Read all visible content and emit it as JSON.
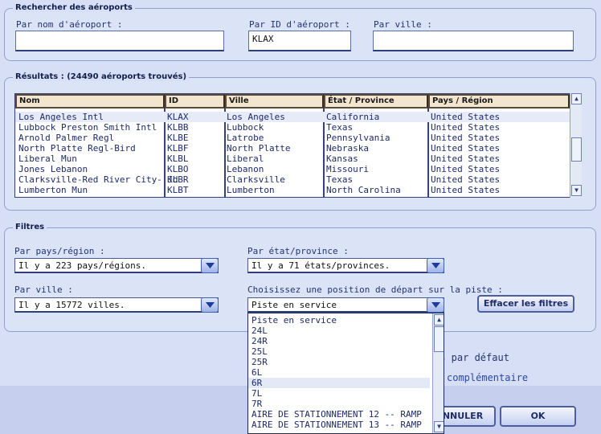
{
  "search": {
    "title": "Rechercher des aéroports",
    "by_name_label": "Par nom d'aéroport :",
    "by_name_value": "",
    "by_id_label": "Par ID d'aéroport :",
    "by_id_value": "KLAX",
    "by_city_label": "Par ville :",
    "by_city_value": ""
  },
  "results": {
    "title": "Résultats : (24490 aéroports trouvés)",
    "columns": [
      "Nom",
      "ID",
      "Ville",
      "État / Province",
      "Pays / Région"
    ],
    "rows": [
      [
        "Los Angeles Intl",
        "KLAX",
        "Los Angeles",
        "California",
        "United States"
      ],
      [
        "Lubbock Preston Smith Intl",
        "KLBB",
        "Lubbock",
        "Texas",
        "United States"
      ],
      [
        "Arnold Palmer Regl",
        "KLBE",
        "Latrobe",
        "Pennsylvania",
        "United States"
      ],
      [
        "North Platte Regl-Bird",
        "KLBF",
        "North Platte",
        "Nebraska",
        "United States"
      ],
      [
        "Liberal Mun",
        "KLBL",
        "Liberal",
        "Kansas",
        "United States"
      ],
      [
        "Jones Lebanon",
        "KLBO",
        "Lebanon",
        "Missouri",
        "United States"
      ],
      [
        "Clarksville-Red River City- Jd",
        "KLBR",
        "Clarksville",
        "Texas",
        "United States"
      ],
      [
        "Lumberton Mun",
        "KLBT",
        "Lumberton",
        "North Carolina",
        "United States"
      ]
    ]
  },
  "filters": {
    "title": "Filtres",
    "country_label": "Par pays/région :",
    "country_value": "Il y a 223 pays/régions.",
    "state_label": "Par état/province :",
    "state_value": "Il y a 71 états/provinces.",
    "city_label": "Par ville :",
    "city_value": "Il y a 15772 villes.",
    "runway_label": "Choisissez une position de départ sur la piste :",
    "runway_value": "Piste en service",
    "clear_button": "Effacer les filtres"
  },
  "runway_dropdown": {
    "options": [
      "Piste en service",
      "24L",
      "24R",
      "25L",
      "25R",
      "6L",
      "6R",
      "7L",
      "7R",
      "AIRE DE STATIONNEMENT 12 -- RAMP",
      "AIRE DE STATIONNEMENT 13 -- RAMP"
    ],
    "highlighted": "6R"
  },
  "background_text": {
    "default_text": "rs par défaut",
    "extra_text": "complémentaire"
  },
  "dialog": {
    "cancel_button": "NNULER",
    "ok_button": "OK"
  }
}
